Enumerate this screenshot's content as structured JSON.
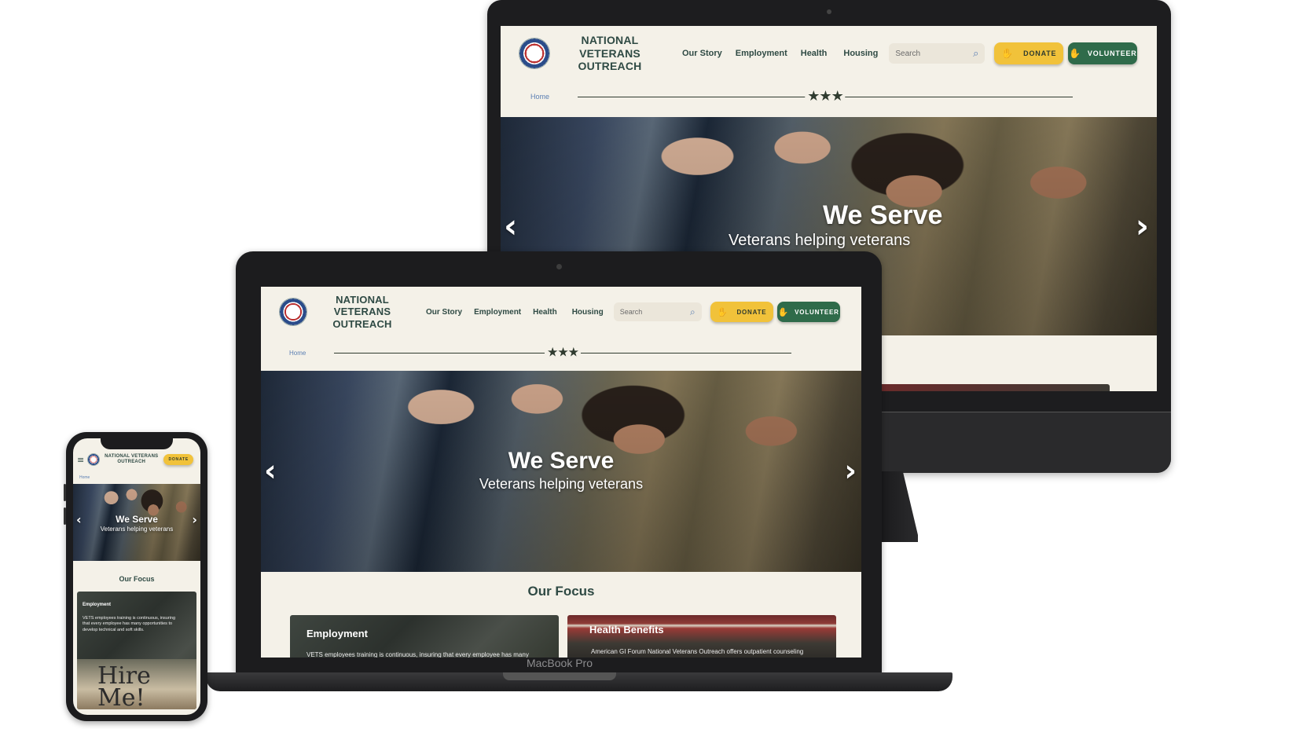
{
  "site": {
    "brand_line1": "NATIONAL VETERANS",
    "brand_line2": "OUTREACH",
    "nav": [
      "Our Story",
      "Employment",
      "Health",
      "Housing"
    ],
    "search_placeholder": "Search",
    "donate_label": "DONATE",
    "volunteer_label": "VOLUNTEER",
    "breadcrumb": "Home",
    "stars": "★★★",
    "hero_title": "We Serve",
    "hero_subtitle": "Veterans helping veterans",
    "prev_arrow": "‹",
    "next_arrow": "›",
    "focus_title": "Our Focus",
    "cards": [
      {
        "title": "Employment",
        "text": "VETS employees training is continuous, insuring that every employee has many opportunities to develop technical and soft skills.",
        "laptop_text": "VETS employees training is continuous, insuring that every employee has many"
      },
      {
        "title": "Health Benefits",
        "text": "American GI Forum National Veterans Outreach  offers outpatient counseling"
      }
    ],
    "phone_card_image_text": "Hire Me!",
    "menu_icon": "≡",
    "search_icon": "⌕",
    "donate_icon": "hand-heart-icon",
    "volunteer_icon": "hand-heart-icon"
  },
  "devices": {
    "laptop_label": "MacBook Pro"
  },
  "colors": {
    "background": "#f4f1e8",
    "brand_text": "#2f4a44",
    "donate": "#f1c23a",
    "volunteer": "#2f6b4a",
    "link": "#5b7fb3"
  }
}
